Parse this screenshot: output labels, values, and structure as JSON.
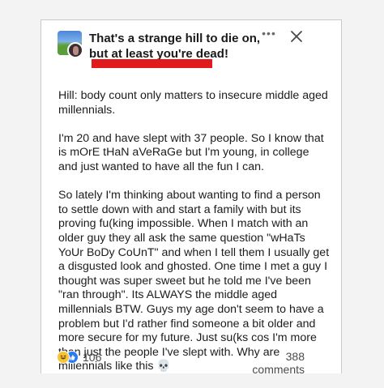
{
  "post": {
    "title": "That's a strange hill to die on, but at least you're dead!",
    "paragraphs": [
      "Hill: body count only matters to insecure middle aged millennials.",
      "I'm 20 and have slept with 37 people. So I know that is mOrE tHaN aVeRaGe but I'm young, in college and just wanted to have all the fun I can.",
      "So lately I'm thinking about wanting to find a person to settle down with and start a family with but its proving fu(king impossible. When I match with an older guy they all ask the same question \"wHaTs YoUr BoDy CoUnT\" and when I tell them I usually get a disgusted look and ghosted. One time I met a guy I thought was super sweet but he told me I've been \"ran through\". Its ALWAYS the middle aged millennials BTW. Guys my age don't seem to have a problem but I'd rather find someone a bit older and more secure for my future. Just su(ks cos I'm more than just the people I've slept with. Why are millennials like this 💀"
    ]
  },
  "header": {
    "more_icon": "more-horizontal-icon",
    "close_icon": "close-icon",
    "redaction_color": "#e11b1b"
  },
  "footer": {
    "reaction_count": "106",
    "comments_label": "388 comments",
    "reaction_icons": [
      "haha-reaction-icon",
      "like-reaction-icon"
    ]
  }
}
